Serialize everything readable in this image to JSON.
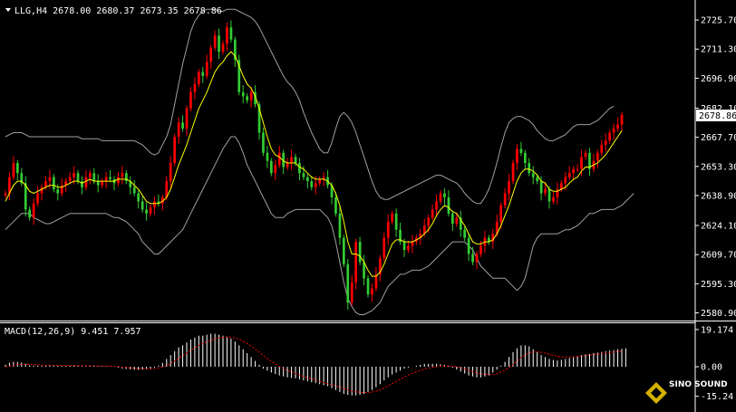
{
  "price_header": "LLG,H4  2678.00 2680.37 2673.35 2678.86",
  "macd_header": "MACD(12,26,9) 9.451 7.957",
  "watermark_text": "SINO SOUND",
  "colors": {
    "background": "#000000",
    "axis": "#ffffff",
    "bull_candle": "#ff0000",
    "bear_candle": "#33cc33",
    "moving_average": "#ffff00",
    "bollinger": "#a0a0a0",
    "macd_hist": "#ffffff",
    "macd_signal": "#ff0000",
    "price_marker_bg": "#ffffff"
  },
  "chart_data": [
    {
      "type": "candlestick",
      "symbol": "LLG",
      "timeframe": "H4",
      "last_price": "2678.86",
      "ylim": [
        2578,
        2732
      ],
      "y_ticks": [
        "2725.70",
        "2711.30",
        "2696.90",
        "2682.10",
        "2667.70",
        "2653.30",
        "2638.90",
        "2624.10",
        "2609.70",
        "2595.30",
        "2580.90"
      ],
      "series": [
        {
          "name": "close",
          "values": [
            2640,
            2648,
            2655,
            2650,
            2645,
            2632,
            2628,
            2635,
            2640,
            2643,
            2646,
            2648,
            2642,
            2640,
            2644,
            2646,
            2648,
            2650,
            2646,
            2643,
            2648,
            2650,
            2646,
            2644,
            2646,
            2648,
            2647,
            2645,
            2648,
            2650,
            2646,
            2643,
            2640,
            2636,
            2632,
            2630,
            2633,
            2636,
            2635,
            2638,
            2646,
            2655,
            2668,
            2675,
            2672,
            2682,
            2690,
            2694,
            2700,
            2698,
            2705,
            2712,
            2718,
            2710,
            2714,
            2722,
            2716,
            2706,
            2690,
            2688,
            2686,
            2690,
            2684,
            2670,
            2660,
            2656,
            2650,
            2654,
            2660,
            2653,
            2655,
            2658,
            2655,
            2650,
            2648,
            2646,
            2643,
            2645,
            2647,
            2648,
            2644,
            2638,
            2630,
            2618,
            2605,
            2586,
            2596,
            2616,
            2606,
            2598,
            2590,
            2593,
            2600,
            2608,
            2618,
            2626,
            2630,
            2622,
            2616,
            2612,
            2614,
            2616,
            2618,
            2620,
            2624,
            2628,
            2632,
            2636,
            2640,
            2638,
            2630,
            2625,
            2628,
            2622,
            2618,
            2610,
            2606,
            2610,
            2614,
            2618,
            2616,
            2620,
            2626,
            2634,
            2640,
            2646,
            2655,
            2662,
            2660,
            2655,
            2650,
            2648,
            2646,
            2640,
            2642,
            2636,
            2638,
            2642,
            2645,
            2648,
            2650,
            2652,
            2652,
            2658,
            2660,
            2652,
            2656,
            2660,
            2664,
            2666,
            2670,
            2672,
            2674,
            2678.86
          ]
        },
        {
          "name": "moving_average",
          "values": [
            2636,
            2640,
            2644,
            2646,
            2646,
            2644,
            2641,
            2640,
            2641,
            2642,
            2643,
            2644,
            2644,
            2643,
            2643,
            2644,
            2645,
            2646,
            2646,
            2645,
            2646,
            2647,
            2646,
            2646,
            2646,
            2646,
            2646,
            2646,
            2647,
            2647,
            2647,
            2646,
            2644,
            2642,
            2639,
            2636,
            2635,
            2635,
            2635,
            2636,
            2638,
            2642,
            2648,
            2654,
            2659,
            2664,
            2670,
            2676,
            2682,
            2686,
            2690,
            2695,
            2700,
            2703,
            2705,
            2708,
            2710,
            2708,
            2703,
            2698,
            2694,
            2692,
            2688,
            2682,
            2675,
            2668,
            2662,
            2659,
            2658,
            2656,
            2655,
            2655,
            2655,
            2653,
            2652,
            2650,
            2648,
            2647,
            2647,
            2647,
            2646,
            2644,
            2640,
            2634,
            2626,
            2616,
            2610,
            2610,
            2609,
            2606,
            2602,
            2599,
            2599,
            2601,
            2605,
            2610,
            2615,
            2617,
            2617,
            2616,
            2616,
            2616,
            2617,
            2618,
            2620,
            2622,
            2625,
            2629,
            2632,
            2634,
            2633,
            2631,
            2630,
            2627,
            2624,
            2620,
            2616,
            2615,
            2615,
            2616,
            2616,
            2617,
            2620,
            2624,
            2629,
            2634,
            2640,
            2646,
            2650,
            2652,
            2652,
            2651,
            2649,
            2646,
            2645,
            2642,
            2641,
            2641,
            2642,
            2643,
            2645,
            2647,
            2648,
            2651,
            2653,
            2653,
            2654,
            2655,
            2657,
            2659,
            2662,
            2665,
            2668,
            2671
          ]
        },
        {
          "name": "bollinger_upper",
          "values": [
            2668,
            2669,
            2670,
            2670,
            2670,
            2669,
            2668,
            2668,
            2668,
            2668,
            2668,
            2668,
            2668,
            2668,
            2668,
            2668,
            2668,
            2668,
            2668,
            2667,
            2667,
            2667,
            2667,
            2667,
            2666,
            2666,
            2666,
            2666,
            2666,
            2666,
            2666,
            2666,
            2666,
            2665,
            2664,
            2662,
            2660,
            2659,
            2660,
            2664,
            2668,
            2674,
            2684,
            2694,
            2704,
            2712,
            2720,
            2725,
            2728,
            2730,
            2731,
            2731,
            2731,
            2730,
            2730,
            2731,
            2731,
            2731,
            2730,
            2729,
            2728,
            2727,
            2725,
            2722,
            2718,
            2714,
            2710,
            2706,
            2702,
            2698,
            2695,
            2693,
            2690,
            2686,
            2680,
            2675,
            2670,
            2666,
            2662,
            2660,
            2660,
            2665,
            2672,
            2678,
            2680,
            2678,
            2675,
            2670,
            2664,
            2658,
            2652,
            2646,
            2641,
            2638,
            2637,
            2637,
            2638,
            2639,
            2640,
            2641,
            2642,
            2643,
            2644,
            2645,
            2646,
            2647,
            2648,
            2649,
            2649,
            2648,
            2647,
            2646,
            2645,
            2643,
            2640,
            2638,
            2636,
            2635,
            2635,
            2638,
            2642,
            2648,
            2655,
            2663,
            2670,
            2675,
            2677,
            2678,
            2678,
            2677,
            2676,
            2674,
            2671,
            2669,
            2667,
            2666,
            2666,
            2667,
            2668,
            2669,
            2671,
            2673,
            2674,
            2674,
            2674,
            2674,
            2675,
            2676,
            2678,
            2680,
            2682,
            2683
          ]
        },
        {
          "name": "bollinger_lower",
          "values": [
            2622,
            2624,
            2626,
            2628,
            2630,
            2630,
            2630,
            2628,
            2627,
            2626,
            2625,
            2625,
            2626,
            2627,
            2628,
            2629,
            2630,
            2630,
            2630,
            2630,
            2630,
            2630,
            2630,
            2630,
            2630,
            2630,
            2629,
            2628,
            2628,
            2627,
            2626,
            2624,
            2622,
            2620,
            2616,
            2614,
            2612,
            2610,
            2610,
            2612,
            2614,
            2616,
            2618,
            2620,
            2622,
            2626,
            2630,
            2634,
            2638,
            2642,
            2646,
            2650,
            2654,
            2658,
            2662,
            2665,
            2668,
            2668,
            2665,
            2660,
            2654,
            2650,
            2646,
            2642,
            2638,
            2634,
            2630,
            2628,
            2628,
            2628,
            2630,
            2631,
            2632,
            2632,
            2632,
            2632,
            2632,
            2632,
            2632,
            2630,
            2628,
            2624,
            2616,
            2606,
            2596,
            2588,
            2584,
            2581,
            2580,
            2580,
            2581,
            2582,
            2584,
            2586,
            2590,
            2594,
            2596,
            2598,
            2600,
            2600,
            2601,
            2602,
            2602,
            2602,
            2603,
            2604,
            2606,
            2608,
            2610,
            2612,
            2614,
            2616,
            2616,
            2616,
            2616,
            2614,
            2612,
            2608,
            2604,
            2602,
            2600,
            2598,
            2598,
            2598,
            2598,
            2596,
            2594,
            2592,
            2594,
            2598,
            2606,
            2614,
            2618,
            2620,
            2620,
            2620,
            2620,
            2620,
            2621,
            2622,
            2622,
            2623,
            2624,
            2626,
            2628,
            2630,
            2630,
            2631,
            2632,
            2632,
            2632,
            2632,
            2633,
            2634,
            2636,
            2638,
            2640
          ]
        }
      ]
    },
    {
      "type": "bar",
      "name": "MACD(12,26,9)",
      "ylim": [
        -21,
        21
      ],
      "y_ticks": [
        "19.174",
        "0.00",
        "-15.24"
      ],
      "series": [
        {
          "name": "macd",
          "values": [
            1,
            2,
            2.5,
            2.5,
            2.2,
            1.5,
            0.8,
            0.6,
            0.5,
            0.5,
            0.6,
            0.7,
            0.6,
            0.5,
            0.5,
            0.5,
            0.6,
            0.7,
            0.6,
            0.4,
            0.4,
            0.5,
            0.4,
            0.3,
            0.3,
            0.3,
            0.2,
            0,
            -0.5,
            -1,
            -1.2,
            -1.4,
            -1.6,
            -1.6,
            -1.4,
            -1.2,
            -1,
            -0.5,
            0.5,
            2,
            4,
            6,
            8,
            10,
            11,
            12.5,
            14,
            15,
            16,
            16,
            16.5,
            17,
            17,
            16.5,
            16,
            15.5,
            14.5,
            13,
            11,
            9,
            7,
            5,
            3,
            1,
            -1,
            -2,
            -3,
            -3.8,
            -4.5,
            -5,
            -5.5,
            -5.8,
            -6,
            -6.5,
            -7,
            -7.5,
            -8,
            -8.5,
            -9,
            -9.5,
            -10,
            -11,
            -12,
            -13,
            -14,
            -14.5,
            -14.8,
            -14.8,
            -14.5,
            -14,
            -13,
            -12,
            -10.5,
            -9,
            -7,
            -5.5,
            -4,
            -3,
            -2,
            -1,
            -0.5,
            0,
            0.5,
            1,
            1.5,
            1.5,
            1.5,
            1.5,
            1.3,
            1,
            0.5,
            -0.5,
            -1.5,
            -2.5,
            -3.5,
            -4.5,
            -5,
            -5.5,
            -5.5,
            -5,
            -4.5,
            -3,
            -1.5,
            0.5,
            2.5,
            5,
            7.5,
            9.5,
            11,
            11,
            10.5,
            9,
            7.5,
            6,
            5,
            4,
            3.5,
            3.2,
            3.5,
            4,
            4.5,
            5,
            5.5,
            6,
            6.3,
            6.6,
            7,
            7.3,
            7.6,
            8,
            8.3,
            8.6,
            9,
            9.2,
            9.451
          ]
        },
        {
          "name": "signal",
          "values": [
            0,
            0.3,
            0.7,
            1.1,
            1.3,
            1.3,
            1.2,
            1.1,
            1,
            0.9,
            0.8,
            0.8,
            0.7,
            0.7,
            0.6,
            0.6,
            0.6,
            0.6,
            0.6,
            0.5,
            0.5,
            0.5,
            0.5,
            0.4,
            0.4,
            0.4,
            0.3,
            0.2,
            0.1,
            -0.2,
            -0.4,
            -0.6,
            -0.8,
            -1,
            -1.1,
            -1.1,
            -1.1,
            -1,
            -0.7,
            -0.2,
            0.6,
            1.7,
            3,
            4.4,
            5.8,
            7.1,
            8.5,
            9.8,
            11,
            12,
            12.9,
            13.7,
            14.4,
            14.9,
            15.2,
            15.3,
            15.2,
            14.8,
            14.1,
            13.1,
            12,
            10.6,
            9.1,
            7.5,
            5.8,
            4.2,
            2.7,
            1.4,
            0.2,
            -0.9,
            -1.9,
            -2.7,
            -3.5,
            -4.3,
            -5,
            -5.6,
            -6.2,
            -6.9,
            -7.5,
            -8.1,
            -8.7,
            -9.3,
            -9.9,
            -10.5,
            -11.2,
            -11.9,
            -12.5,
            -12.9,
            -13.2,
            -13.3,
            -13.3,
            -13.1,
            -12.6,
            -11.9,
            -10.9,
            -9.9,
            -8.7,
            -7.5,
            -6.4,
            -5.3,
            -4.3,
            -3.4,
            -2.6,
            -1.9,
            -1.2,
            -0.7,
            -0.3,
            0,
            0.3,
            0.4,
            0.4,
            0.2,
            -0.1,
            -0.6,
            -1.2,
            -1.9,
            -2.5,
            -3.1,
            -3.6,
            -3.9,
            -4.1,
            -4,
            -3.6,
            -2.8,
            -1.8,
            -0.5,
            1.1,
            2.9,
            4.7,
            6.1,
            7.1,
            7.6,
            7.7,
            7.4,
            6.9,
            6.4,
            5.9,
            5.4,
            5.1,
            5,
            5,
            5.1,
            5.3,
            5.5,
            5.8,
            6,
            6.3,
            6.5,
            6.8,
            7.1,
            7.3,
            7.6,
            7.8,
            7.957
          ]
        }
      ]
    }
  ]
}
